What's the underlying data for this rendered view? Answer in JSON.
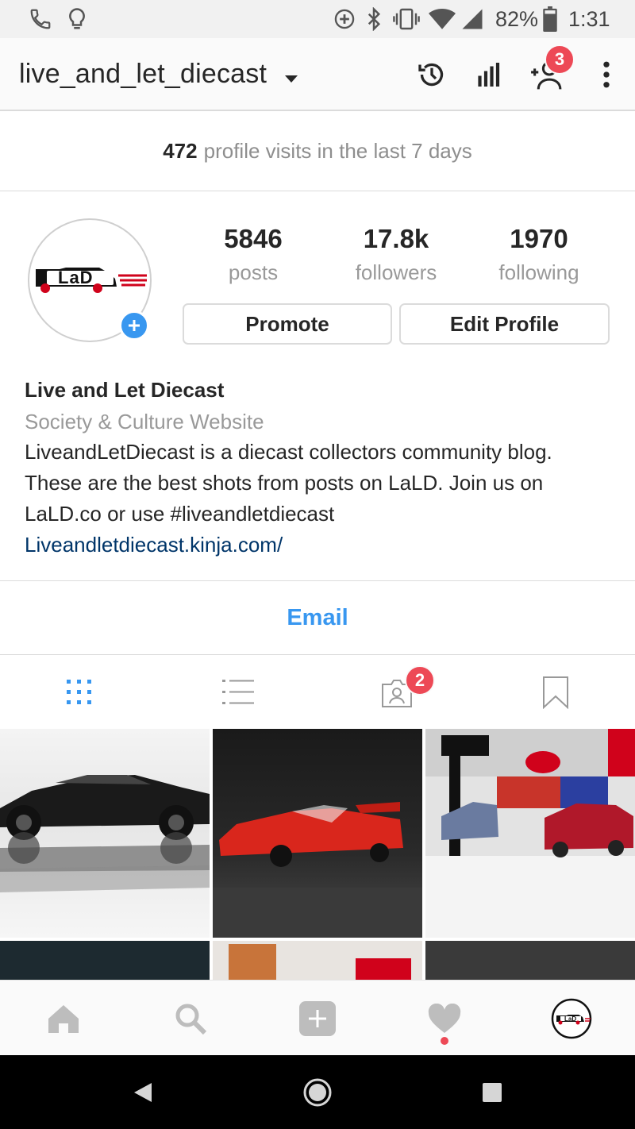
{
  "status_bar": {
    "battery": "82%",
    "time": "1:31",
    "icons": [
      "phone-icon",
      "lightbulb-icon",
      "data-saver-icon",
      "bluetooth-icon",
      "vibrate-icon",
      "wifi-icon",
      "signal-icon",
      "battery-icon"
    ]
  },
  "header": {
    "username": "live_and_let_diecast",
    "icons": [
      "history-icon",
      "insights-icon",
      "add-person-icon",
      "more-icon"
    ],
    "discover_badge": "3"
  },
  "visits": {
    "count": "472",
    "label": "profile visits in the last 7 days"
  },
  "profile": {
    "avatar_logo": "LaD",
    "stats": [
      {
        "value": "5846",
        "label": "posts"
      },
      {
        "value": "17.8k",
        "label": "followers"
      },
      {
        "value": "1970",
        "label": "following"
      }
    ],
    "promote_label": "Promote",
    "edit_label": "Edit Profile"
  },
  "bio": {
    "name": "Live and Let Diecast",
    "category": "Society & Culture Website",
    "lines": [
      "LiveandLetDiecast is a diecast collectors community blog.",
      "These are the best shots from posts on LaLD. Join us on",
      "LaLD.co or use #liveandletdiecast"
    ],
    "link": "Liveandletdiecast.kinja.com/"
  },
  "contact": {
    "email_label": "Email"
  },
  "tabs": {
    "icons": [
      "grid-icon",
      "list-icon",
      "tagged-icon",
      "saved-icon"
    ],
    "tagged_badge": "2"
  },
  "bottom_nav": {
    "icons": [
      "home-icon",
      "search-icon",
      "new-post-icon",
      "activity-heart-icon",
      "profile-avatar-icon"
    ],
    "profile_logo": "LaD"
  },
  "colors": {
    "accent_blue": "#3897f0",
    "badge_red": "#ed4956",
    "link_dark_blue": "#003569"
  }
}
